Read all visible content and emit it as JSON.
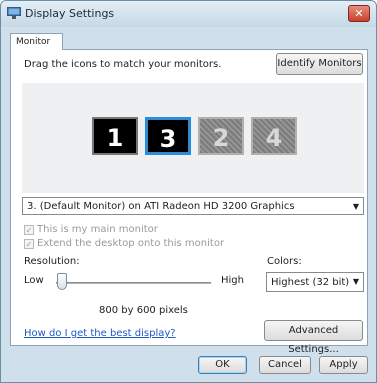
{
  "window": {
    "title": "Display Settings",
    "close_symbol": "✕"
  },
  "tab": {
    "label": "Monitor"
  },
  "instructions": "Drag the icons to match your monitors.",
  "identify_button": "Identify Monitors",
  "monitors": [
    {
      "number": "1",
      "state": "active"
    },
    {
      "number": "3",
      "state": "selected"
    },
    {
      "number": "2",
      "state": "disabled"
    },
    {
      "number": "4",
      "state": "disabled"
    }
  ],
  "monitor_select": {
    "value": "3. (Default Monitor) on ATI Radeon HD 3200 Graphics",
    "arrow": "▼"
  },
  "checkboxes": {
    "main_monitor": {
      "label": "This is my main monitor",
      "checked": true,
      "enabled": false,
      "mark": "✓"
    },
    "extend_desktop": {
      "label": "Extend the desktop onto this monitor",
      "checked": true,
      "enabled": false,
      "mark": "✓"
    }
  },
  "resolution": {
    "label": "Resolution:",
    "low": "Low",
    "high": "High",
    "value": "800 by 600 pixels",
    "slider_position": 0
  },
  "colors": {
    "label": "Colors:",
    "value": "Highest (32 bit)",
    "arrow": "▼"
  },
  "help_link": "How do I get the best display?",
  "advanced_button": "Advanced Settings...",
  "buttons": {
    "ok": "OK",
    "cancel": "Cancel",
    "apply": "Apply"
  },
  "colors_palette": {
    "selected_border": "#2e8bd6",
    "link": "#2158c9",
    "close": "#c9412b"
  },
  "icons": {
    "app": "display-settings-icon",
    "close": "close-icon"
  }
}
